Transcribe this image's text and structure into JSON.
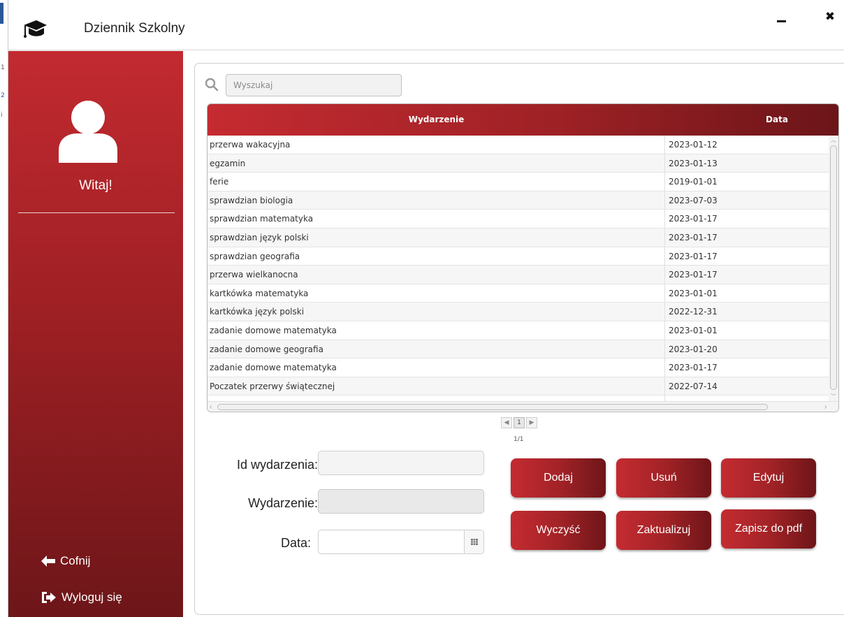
{
  "window": {
    "title": "Dziennik Szkolny",
    "icons": {
      "logo": "graduation-cap-icon",
      "minimize": "minimize-icon",
      "close": "close-icon"
    },
    "close_glyph": "✖"
  },
  "edge_fragments": [
    "1",
    "2",
    "i"
  ],
  "sidebar": {
    "welcome": "Witaj!",
    "avatar_icon": "user-icon",
    "back_label": "Cofnij",
    "logout_label": "Wyloguj się",
    "colors": {
      "top": "#c22a30",
      "bottom": "#6d1619"
    }
  },
  "search": {
    "placeholder": "Wyszukaj",
    "value": ""
  },
  "table": {
    "headers": {
      "event": "Wydarzenie",
      "date": "Data"
    },
    "rows": [
      {
        "event": "przerwa wakacyjna",
        "date": "2023-01-12"
      },
      {
        "event": "egzamin",
        "date": "2023-01-13"
      },
      {
        "event": "ferie",
        "date": "2019-01-01"
      },
      {
        "event": "sprawdzian biologia",
        "date": "2023-07-03"
      },
      {
        "event": "sprawdzian matematyka",
        "date": "2023-01-17"
      },
      {
        "event": "sprawdzian język polski",
        "date": "2023-01-17"
      },
      {
        "event": "sprawdzian geografia",
        "date": "2023-01-17"
      },
      {
        "event": "przerwa wielkanocna",
        "date": "2023-01-17"
      },
      {
        "event": "kartkówka matematyka",
        "date": "2023-01-01"
      },
      {
        "event": "kartkówka język polski",
        "date": "2022-12-31"
      },
      {
        "event": "zadanie domowe matematyka",
        "date": "2023-01-01"
      },
      {
        "event": "zadanie domowe geografia",
        "date": "2023-01-20"
      },
      {
        "event": "zadanie domowe matematyka",
        "date": "2023-01-17"
      },
      {
        "event": "Poczatek przerwy świątecznej",
        "date": "2022-07-14"
      }
    ]
  },
  "pagination": {
    "prev": "◀",
    "page": "1",
    "next": "▶",
    "info": "1/1"
  },
  "form": {
    "id_label": "Id wydarzenia:",
    "id_value": "",
    "event_label": "Wydarzenie:",
    "event_value": "",
    "date_label": "Data:",
    "date_value": ""
  },
  "buttons": {
    "add": "Dodaj",
    "delete": "Usuń",
    "edit": "Edytuj",
    "clear": "Wyczyść",
    "update": "Zaktualizuj",
    "pdf": "Zapisz do pdf"
  },
  "accent": "#a32327"
}
